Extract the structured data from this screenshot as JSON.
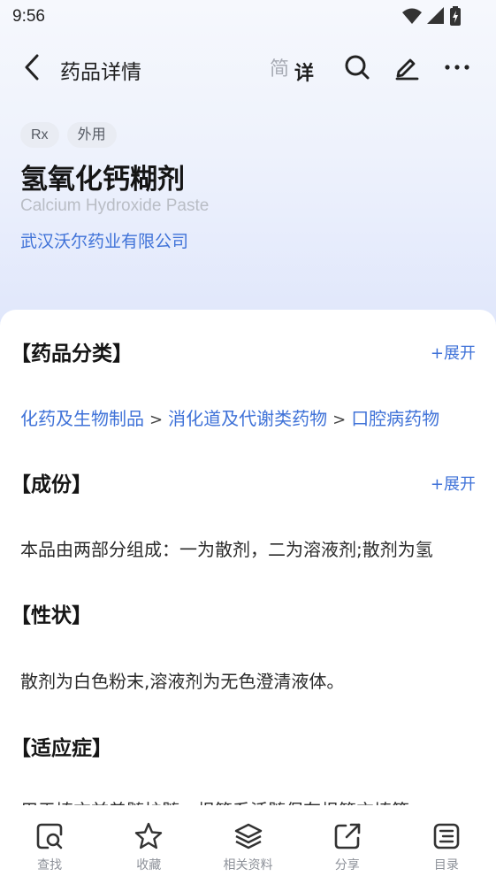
{
  "status_bar": {
    "time": "9:56"
  },
  "nav": {
    "title": "药品详情",
    "mode_simple": "简",
    "mode_detail": "详"
  },
  "drug": {
    "tags": [
      "Rx",
      "外用"
    ],
    "name": "氢氧化钙糊剂",
    "english_name": "Calcium Hydroxide Paste",
    "manufacturer": "武汉沃尔药业有限公司"
  },
  "sections": {
    "classification": {
      "title": "【药品分类】",
      "expand_label": "+展开",
      "path": [
        "化药及生物制品",
        "消化道及代谢类药物",
        "口腔病药物"
      ],
      "separator": ">"
    },
    "ingredients": {
      "title": "【成份】",
      "expand_label": "+展开",
      "text": "本品由两部分组成：一为散剂，二为溶液剂;散剂为氢"
    },
    "properties": {
      "title": "【性状】",
      "text": "散剂为白色粉末,溶液剂为无色澄清液体。"
    },
    "indications": {
      "title": "【适应症】",
      "text": "用于填充前盖髓护髓、根管系活髓保存根管充填等"
    }
  },
  "bottom_tabs": [
    {
      "label": "查找",
      "icon": "search-doc-icon"
    },
    {
      "label": "收藏",
      "icon": "star-icon"
    },
    {
      "label": "相关资料",
      "icon": "layers-icon"
    },
    {
      "label": "分享",
      "icon": "share-icon"
    },
    {
      "label": "目录",
      "icon": "catalog-icon"
    }
  ],
  "colors": {
    "accent": "#3f72d8",
    "hero_gradient_end": "#dfe6fb"
  }
}
